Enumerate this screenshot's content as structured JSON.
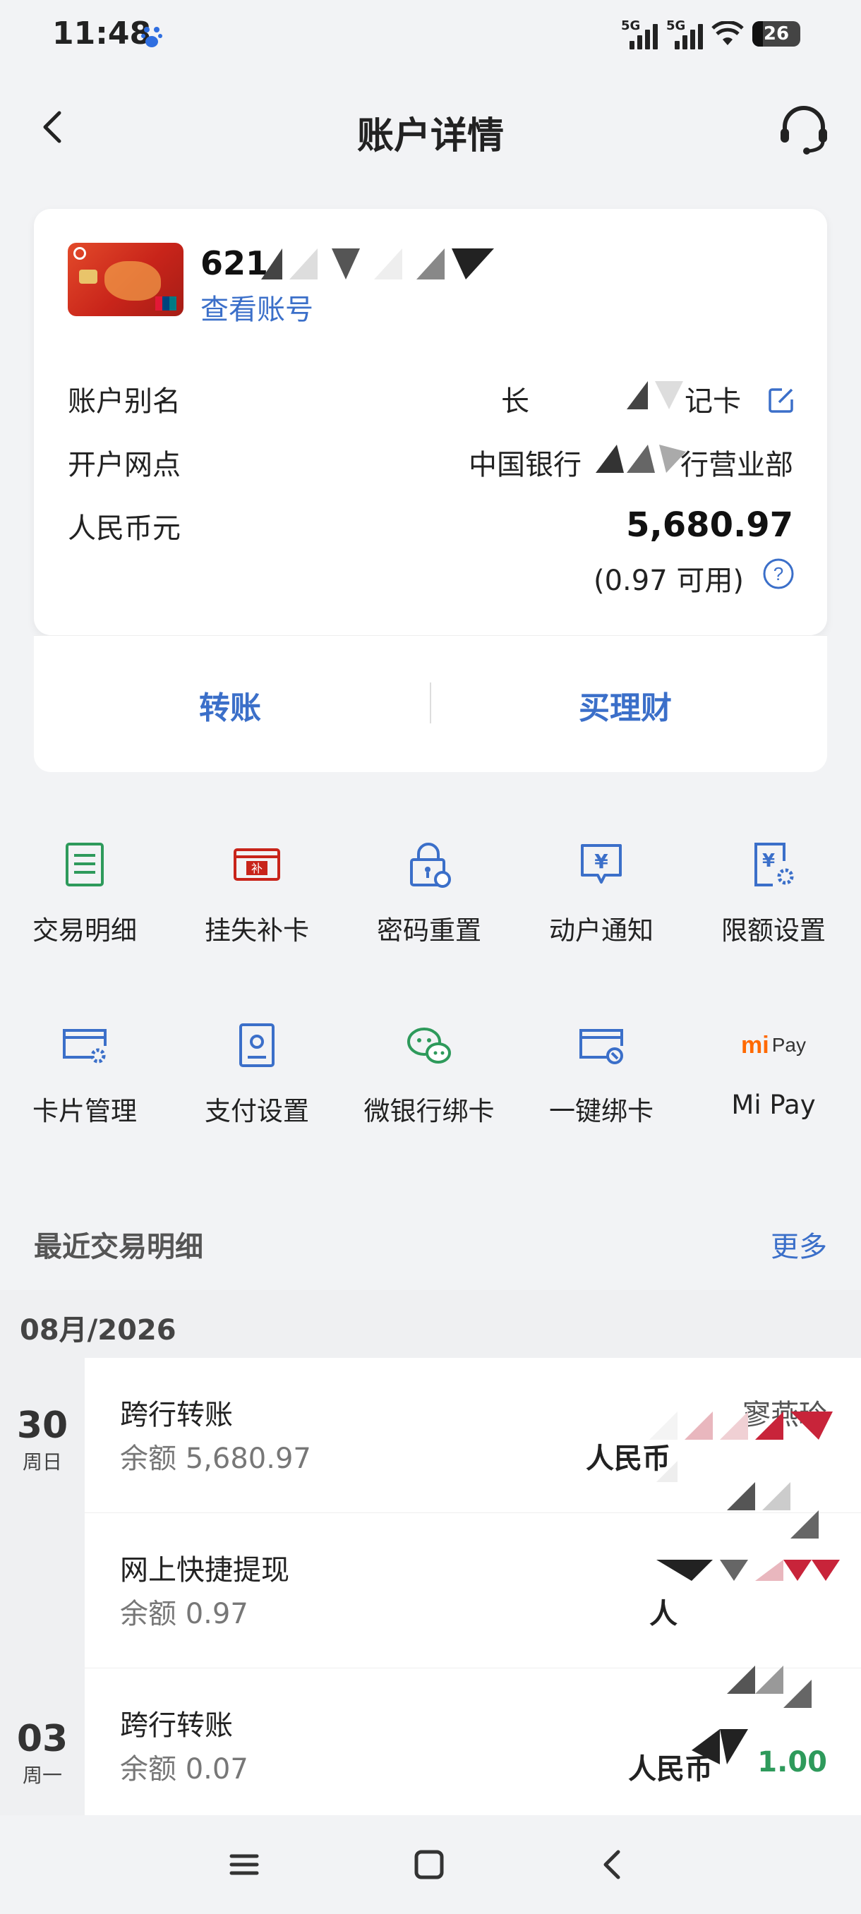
{
  "status_bar": {
    "time": "11:48",
    "net1": "5G",
    "net2": "5G",
    "battery": "26"
  },
  "nav": {
    "title": "账户详情"
  },
  "card": {
    "number_visible": "621",
    "view_number_label": "查看账号",
    "alias_label": "账户别名",
    "alias_value_start": "长",
    "alias_value_end": "记卡",
    "branch_label": "开户网点",
    "branch_value_start": "中国银行",
    "branch_value_end": "行营业部",
    "currency_label": "人民币元",
    "balance": "5,680.97",
    "available": "(0.97 可用)"
  },
  "actions": {
    "transfer": "转账",
    "wealth": "买理财"
  },
  "grid": [
    {
      "label": "交易明细",
      "icon": "document-list-icon"
    },
    {
      "label": "挂失补卡",
      "icon": "card-replace-icon"
    },
    {
      "label": "密码重置",
      "icon": "password-reset-icon"
    },
    {
      "label": "动户通知",
      "icon": "notice-icon"
    },
    {
      "label": "限额设置",
      "icon": "limit-settings-icon"
    },
    {
      "label": "卡片管理",
      "icon": "card-manage-icon"
    },
    {
      "label": "支付设置",
      "icon": "payment-settings-icon"
    },
    {
      "label": "微银行绑卡",
      "icon": "wechat-bind-icon"
    },
    {
      "label": "一键绑卡",
      "icon": "quick-bind-icon"
    },
    {
      "label": "Mi Pay",
      "icon": "mi-pay-icon",
      "logo_text": "Pay"
    }
  ],
  "recent": {
    "title": "最近交易明细",
    "more": "更多",
    "month": "08月/2026",
    "dates": [
      {
        "day": "30",
        "weekday": "周日"
      },
      {
        "day": "03",
        "weekday": "周一"
      }
    ],
    "transactions": [
      {
        "title": "跨行转账",
        "balance": "余额 5,680.97",
        "counterparty": "寥燕玲",
        "amount_prefix": "人民币",
        "amount_value": ""
      },
      {
        "title": "网上快捷提现",
        "balance": "余额 0.97",
        "counterparty": "",
        "amount_prefix": "人",
        "amount_value": ""
      },
      {
        "title": "跨行转账",
        "balance": "余额 0.07",
        "counterparty": "",
        "amount_prefix": "人民币",
        "amount_value": "1.00"
      }
    ]
  },
  "colors": {
    "accent": "#3b6fc9",
    "green": "#2e9a5b",
    "red": "#c8241a"
  }
}
